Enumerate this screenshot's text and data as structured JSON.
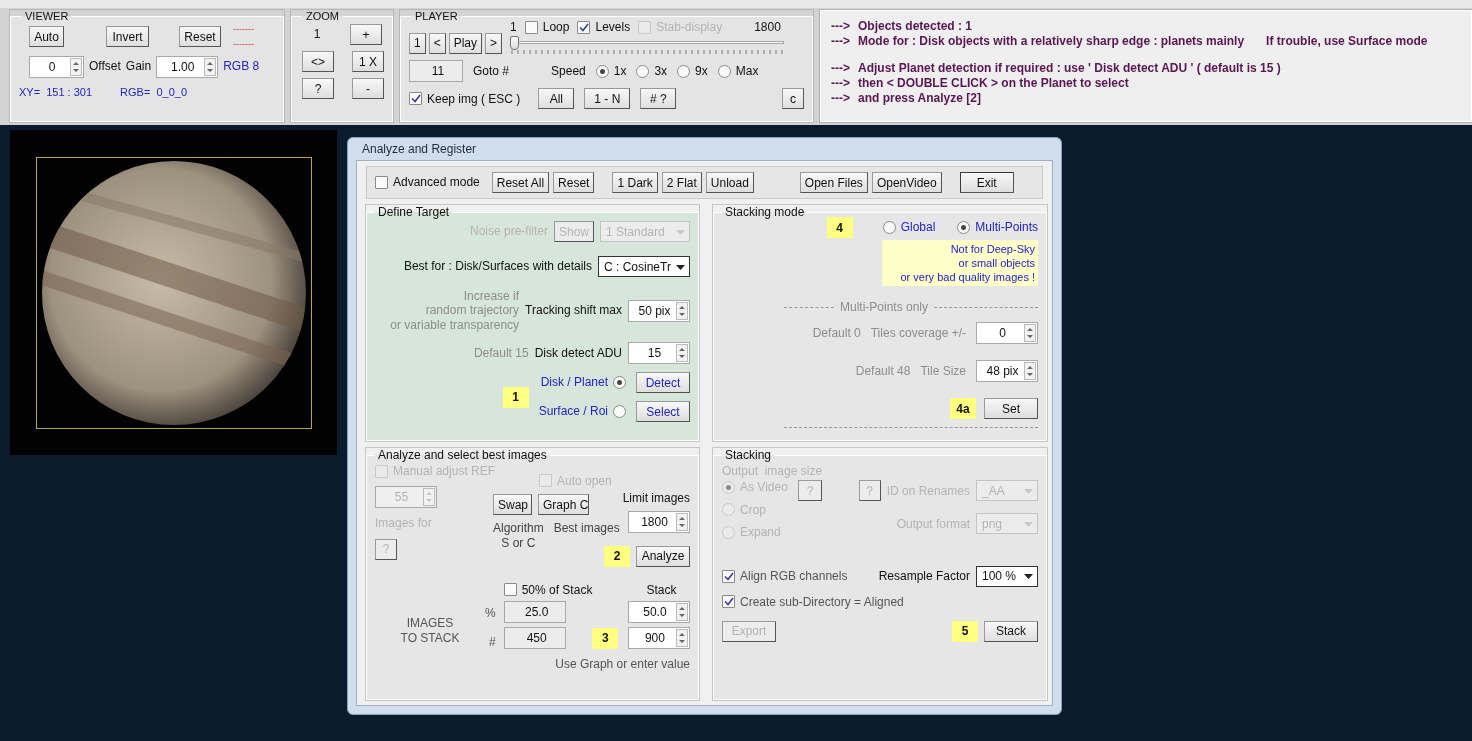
{
  "viewer": {
    "title": "VIEWER",
    "buttons": [
      "Auto",
      "Invert",
      "Reset"
    ],
    "marks": [
      "-------",
      "-------"
    ],
    "offset_value": "0",
    "offset_label": "Offset",
    "gain_label": "Gain",
    "gain_value": "1.00",
    "rgb_mode": "RGB 8",
    "xy": "XY=  151 : 301",
    "rgb": "RGB=  0_0_0"
  },
  "zoom": {
    "title": "ZOOM",
    "zoom_value": "1",
    "buttons": [
      "+",
      "<>",
      "1 X",
      "?",
      "-"
    ]
  },
  "player": {
    "title": "PLAYER",
    "nav_buttons": [
      "1",
      "<",
      "Play",
      ">"
    ],
    "start": "1",
    "end": "1800",
    "loop": {
      "label": "Loop",
      "checked": false
    },
    "levels": {
      "label": "Levels",
      "checked": true
    },
    "stab_display": {
      "label": "Stab-display",
      "checked": false,
      "disabled": true
    },
    "slider": {
      "level": 0
    },
    "goto_value": "11",
    "goto_label": "Goto #",
    "speed_label": "Speed",
    "speeds": [
      {
        "label": "1x",
        "selected": true
      },
      {
        "label": "3x",
        "selected": false
      },
      {
        "label": "9x",
        "selected": false
      },
      {
        "label": "Max",
        "selected": false
      }
    ],
    "keep_img": {
      "label": "Keep img ( ESC )",
      "checked": true
    },
    "buttons": [
      "All",
      "1 - N",
      "# ?"
    ],
    "c_button": "c"
  },
  "message_groups": [
    [
      {
        "arrow": "--->",
        "text": "Objects detected :   1"
      },
      {
        "arrow": "--->",
        "text": "Mode for :  Disk objects with a relatively sharp edge :  planets mainly",
        "note": "If trouble, use Surface mode"
      }
    ],
    [
      {
        "arrow": "--->",
        "text": "Adjust Planet detection if required :   use  ' Disk detect ADU '   ( default is 15 )"
      },
      {
        "arrow": "--->",
        "text": "then < DOUBLE CLICK > on the Planet to select"
      },
      {
        "arrow": "--->",
        "text": "and press Analyze  [2]"
      }
    ]
  ],
  "dialog": {
    "title": "Analyze and Register",
    "advanced": {
      "label": "Advanced mode",
      "checked": false
    },
    "button_groups": [
      [
        "Reset All",
        "Reset"
      ],
      [
        "1 Dark",
        "2 Flat",
        "Unload"
      ],
      [
        "Open Files",
        "OpenVideo"
      ],
      [
        "Exit"
      ]
    ],
    "define_target": {
      "title": "Define Target",
      "noise_label": "Noise pre-filter",
      "show_button": "Show",
      "noise_select": "1 Standard",
      "best_for_label": "Best for : Disk/Surfaces with details",
      "algorithm_select": "C : CosineTr",
      "tracking_hint": "Increase if\nrandom trajectory\nor variable transparency",
      "tracking_label": "Tracking shift max",
      "tracking_value": "50 pix",
      "adu_default": "Default 15",
      "adu_label": "Disk detect ADU",
      "adu_value": "15",
      "step": "1",
      "modes": [
        {
          "label": "Disk / Planet",
          "selected": true,
          "button": "Detect"
        },
        {
          "label": "Surface / Roi",
          "selected": false,
          "button": "Select"
        }
      ]
    },
    "stacking_mode": {
      "title": "Stacking mode",
      "step": "4",
      "options": [
        {
          "label": "Global",
          "selected": false
        },
        {
          "label": "Multi-Points",
          "selected": true
        }
      ],
      "warning": "Not for Deep-Sky\nor small objects\nor very bad quality images !",
      "multi_label": "Multi-Points only",
      "tiles_default": "Default 0",
      "tiles_label": "Tiles coverage +/-",
      "tiles_value": "0",
      "size_default": "Default 48",
      "size_label": "Tile Size",
      "size_value": "48 pix",
      "set_step": "4a",
      "set_button": "Set"
    },
    "analyze": {
      "title": "Analyze and select best images",
      "manual_ref": {
        "label": "Manual adjust REF",
        "checked": false,
        "disabled": true
      },
      "auto_open": {
        "label": "Auto open",
        "checked": false,
        "disabled": true
      },
      "limit_label": "Limit images",
      "ref_value": "55",
      "swap_button": "Swap",
      "graph_button": "Graph C",
      "limit_value": "1800",
      "images_for": "Images for",
      "help_button": "?",
      "algorithm_note": "Algorithm\nS or C",
      "best_images": "Best images",
      "step": "2",
      "analyze_button": "Analyze",
      "half_stack": {
        "label": "50% of Stack",
        "checked": false,
        "disabled": false
      },
      "stack_label": "Stack",
      "images_to_stack": "IMAGES\nTO STACK",
      "pct_label": "%",
      "pct_value": "25.0",
      "count_label": "#",
      "count_value": "450",
      "stack_pct": "50.0",
      "stack_count": "900",
      "stack_step": "3",
      "hint": "Use Graph or enter value"
    },
    "stacking": {
      "title": "Stacking",
      "output_label": "Output  image size",
      "sizes": [
        {
          "label": "As Video",
          "selected": true
        },
        {
          "label": "Crop",
          "selected": false
        },
        {
          "label": "Expand",
          "selected": false
        }
      ],
      "help_buttons": [
        "?",
        "?"
      ],
      "id_label": "ID on Renames",
      "id_value": "_AA",
      "format_label": "Output format",
      "format_value": "png",
      "align": {
        "label": "Align RGB channels",
        "checked": true,
        "disabled": false
      },
      "resample_label": "Resample Factor",
      "resample_value": "100 %",
      "subdir": {
        "label": "Create sub-Directory = Aligned",
        "checked": true,
        "disabled": false
      },
      "export_button": "Export",
      "step": "5",
      "stack_button": "Stack"
    }
  }
}
